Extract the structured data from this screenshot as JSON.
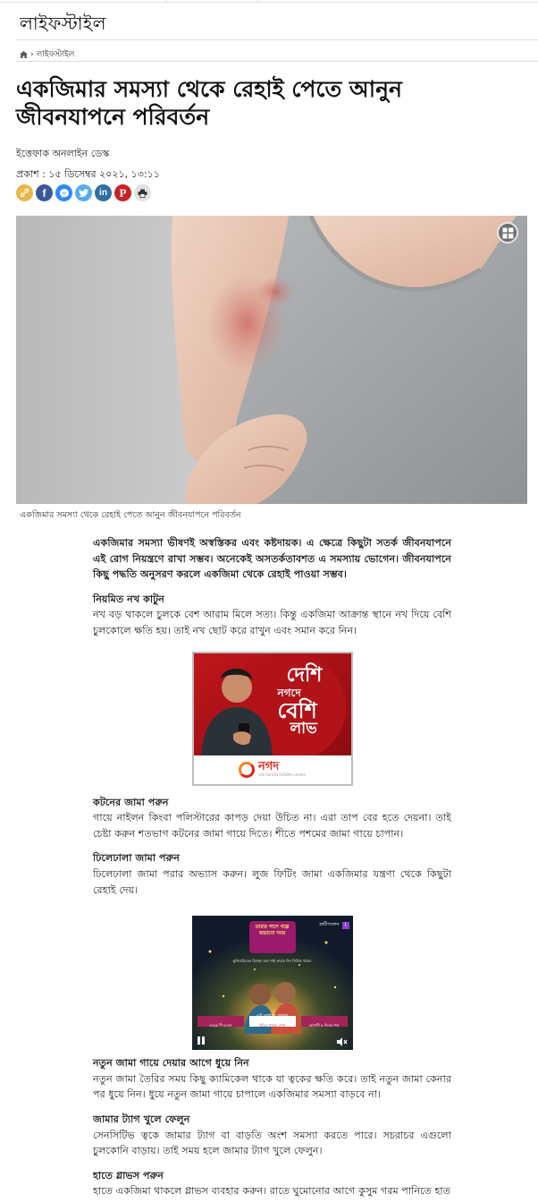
{
  "section": {
    "title": "লাইফস্টাইল"
  },
  "breadcrumb": {
    "home_icon": "home-icon",
    "separator": "›",
    "current": "লাইফস্টাইল"
  },
  "article": {
    "headline": "একজিমার সমস্যা থেকে রেহাই পেতে আনুন জীবনযাপনে পরিবর্তন",
    "author": "ইত্তেফাক অনলাইন ডেস্ক",
    "published": "প্রকাশ : ১৫ ডিসেম্বর ২০২১, ১৩:১১",
    "image_caption": "একজিমার সমস্যা থেকে রেহাই পেতে আনুন জীবনযাপনে পরিবর্তন",
    "lead": "একজিমার সমস্যা ভীষণই অস্বস্তিকর এবং কষ্টদায়ক। এ ক্ষেত্রে কিছুটা সতর্ক জীবনযাপনে এই রোগ নিয়ন্ত্রণে রাখা সম্ভব। অনেকেই অসতর্কতাবশত এ সমস্যায় ভোগেন। জীবনযাপনে কিছু পদ্ধতি অনুসরণ করলে একজিমা থেকে রেহাই পাওয়া সম্ভব।",
    "sections": [
      {
        "heading": "নিয়মিত নখ কাটুন",
        "text": "নখ বড় থাকলে চুলকে বেশ আরাম মিলে সত্য। কিন্তু একজিমা আক্রান্ত স্থানে নখ দিয়ে বেশি চুলকোলে ক্ষতি হয়। তাই নখ ছোট করে রাখুন এবং সমান করে নিন।"
      },
      {
        "heading": "কটনের জামা পরুন",
        "text": "গায়ে নাইলন কিংবা পলিস্টারের কাপড় দেয়া উচিত না। এরা তাপ বের হতে দেয়না। তাই চেষ্টা করুন শতভাগ কটনের জামা গায়ে দিতে। শীতে পশমের জামা গায়ে চাপান।"
      },
      {
        "heading": "ঢিলেঢালা জামা পরুন",
        "text": "ঢিলেঢালা জামা পরার অভ্যাস করুন। লুজ ফিটিং জামা একজিমার যন্ত্রণা থেকে কিছুটা রেহাই দেয়।"
      },
      {
        "heading": "নতুন জামা গায়ে দেয়ার আগে ধুয়ে নিন",
        "text": "নতুন জামা তৈরির সময় কিছু ক্যামিকেল থাকে যা ত্বকের ক্ষতি করে। তাই নতুন জামা কেনার পর ধুয়ে নিন। ধুয়ে নতুন জামা গায়ে চাপালে একজিমার সমস্যা বাড়বে না।"
      },
      {
        "heading": "জামার ট্যাগ খুলে ফেলুন",
        "text": "সেনসিটিভ ত্বকে জামার ট্যাগ বা বাড়তি অংশ সমস্যা করতে পারে। সচরাচর এগুলো চুলকোনি বাড়ায়। তাই সময় হলে জামার ট্যাগ খুলে ফেলুন।"
      },
      {
        "heading": "হাতে গ্লাভস পরুন",
        "text": "হাতে একজিমা থাকলে গ্লাভস ব্যবহার করুন। রাতে ঘুমোনোর আগে কুসুম গরম পানিতে হাত"
      }
    ]
  },
  "ads": {
    "nagad": {
      "headline_line1": "দেশি",
      "headline_line2": "নগদে",
      "headline_line3": "বেশি",
      "headline_line4": "লাভ",
      "brand": "নগদ",
      "tagline": "ডাক বিভাগের ডিজিটাল লেনদেন"
    },
    "grameenphone": {
      "brand": "গ্রামীণফোন",
      "title": "তারার পাশে গল্পে জড়ানো সময়",
      "sub": "ভুলিবারিতের বিচ্ছেদ মনে সাই তারার দিন সিরিজ থাকে।",
      "week": "এই সপ্তাহে ফেলুন",
      "tiles": [
        "ডেলুক দী চলেন",
        "বিচিত্র গল্পের দেখা",
        "আগামী ৫ দিনের গল্প"
      ]
    }
  },
  "share_icons": [
    {
      "name": "copy-link-icon",
      "color": "#e8b84a"
    },
    {
      "name": "facebook-icon",
      "color": "#3b5998"
    },
    {
      "name": "messenger-icon",
      "color": "#2d88ff"
    },
    {
      "name": "twitter-icon",
      "color": "#55acee"
    },
    {
      "name": "linkedin-icon",
      "color": "#2f6fa6"
    },
    {
      "name": "pinterest-icon",
      "color": "#cb2027"
    },
    {
      "name": "print-icon",
      "color": "#e0e0e0"
    }
  ]
}
